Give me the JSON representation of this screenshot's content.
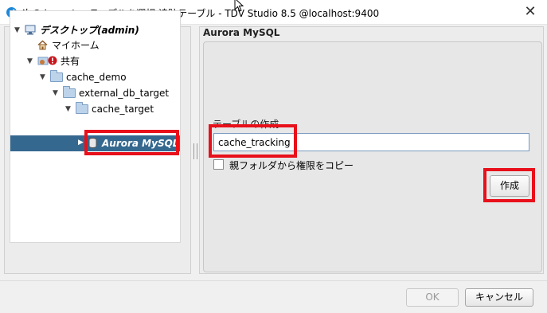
{
  "window": {
    "title": "次のキャッシュテーブルを選択 追跡テーブル - TDV Studio 8.5 @localhost:9400",
    "close_glyph": "✕"
  },
  "tree": {
    "nodes": [
      {
        "label": "デスクトップ(admin)",
        "expanded": true
      },
      {
        "label": "マイホーム"
      },
      {
        "label": "共有",
        "expanded": true
      },
      {
        "label": "cache_demo",
        "expanded": true
      },
      {
        "label": "external_db_target",
        "expanded": true
      },
      {
        "label": "cache_target",
        "expanded": true
      },
      {
        "label": "Aurora MySQL",
        "selected": true
      }
    ]
  },
  "right_panel": {
    "header": "Aurora MySQL",
    "create_table_label": "テーブルの作成",
    "table_name_value": "cache_tracking",
    "copy_permissions_label": "親フォルダから権限をコピー",
    "copy_permissions_checked": false,
    "create_button": "作成"
  },
  "footer": {
    "ok_button": "OK",
    "cancel_button": "キャンセル"
  },
  "colors": {
    "selection": "#35688f",
    "highlight": "#e8101a",
    "folder": "#bcd3ea"
  }
}
